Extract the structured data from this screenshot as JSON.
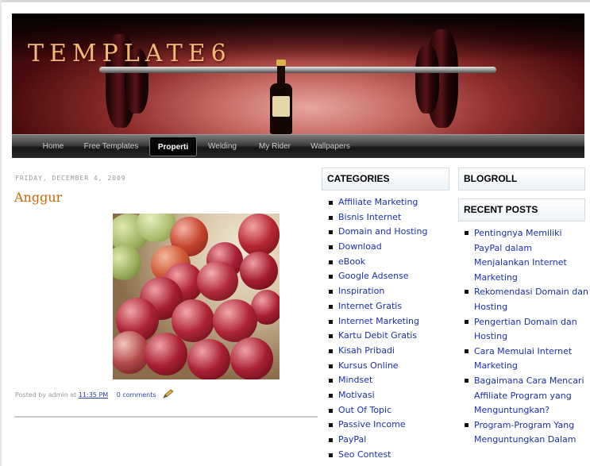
{
  "header": {
    "blog_title": "TEMPLATE6"
  },
  "nav": {
    "items": [
      "Home",
      "Free Templates",
      "Properti",
      "Welding",
      "My Rider",
      "Wallpapers"
    ],
    "active": "Properti"
  },
  "post": {
    "date": "FRIDAY, DECEMBER 4, 2009",
    "title": "Anggur",
    "image_alt": "grapes",
    "posted_by_prefix": "Posted by admin at",
    "time": "11:35 PM",
    "comments": "0 comments",
    "edit_icon": "pencil-icon"
  },
  "categories": {
    "heading": "CATEGORIES",
    "items": [
      "Affiliate Marketing",
      "Bisnis Internet",
      "Domain and Hosting",
      "Download",
      "eBook",
      "Google Adsense",
      "Inspiration",
      "Internet Gratis",
      "Internet Marketing",
      "Kartu Debit Gratis",
      "Kisah Pribadi",
      "Kursus Online",
      "Mindset",
      "Motivasi",
      "Out Of Topic",
      "Passive Income",
      "PayPal",
      "Seo Contest"
    ]
  },
  "blogroll": {
    "heading": "BLOGROLL"
  },
  "recent_posts": {
    "heading": "RECENT POSTS",
    "items": [
      "Pentingnya Memiliki PayPal dalam Menjalankan Internet Marketing",
      "Rekomendasi Domain dan Hosting",
      "Pengertian Domain dan Hosting",
      "Cara Memulai Internet Marketing",
      "Bagaimana Cara Mencari Affiliate Program yang Menguntungkan?",
      "Program-Program Yang Menguntungkan Dalam"
    ]
  },
  "colors": {
    "link": "#1a2fb0",
    "post_title": "#cc6600",
    "blog_title": "#f2b978"
  }
}
